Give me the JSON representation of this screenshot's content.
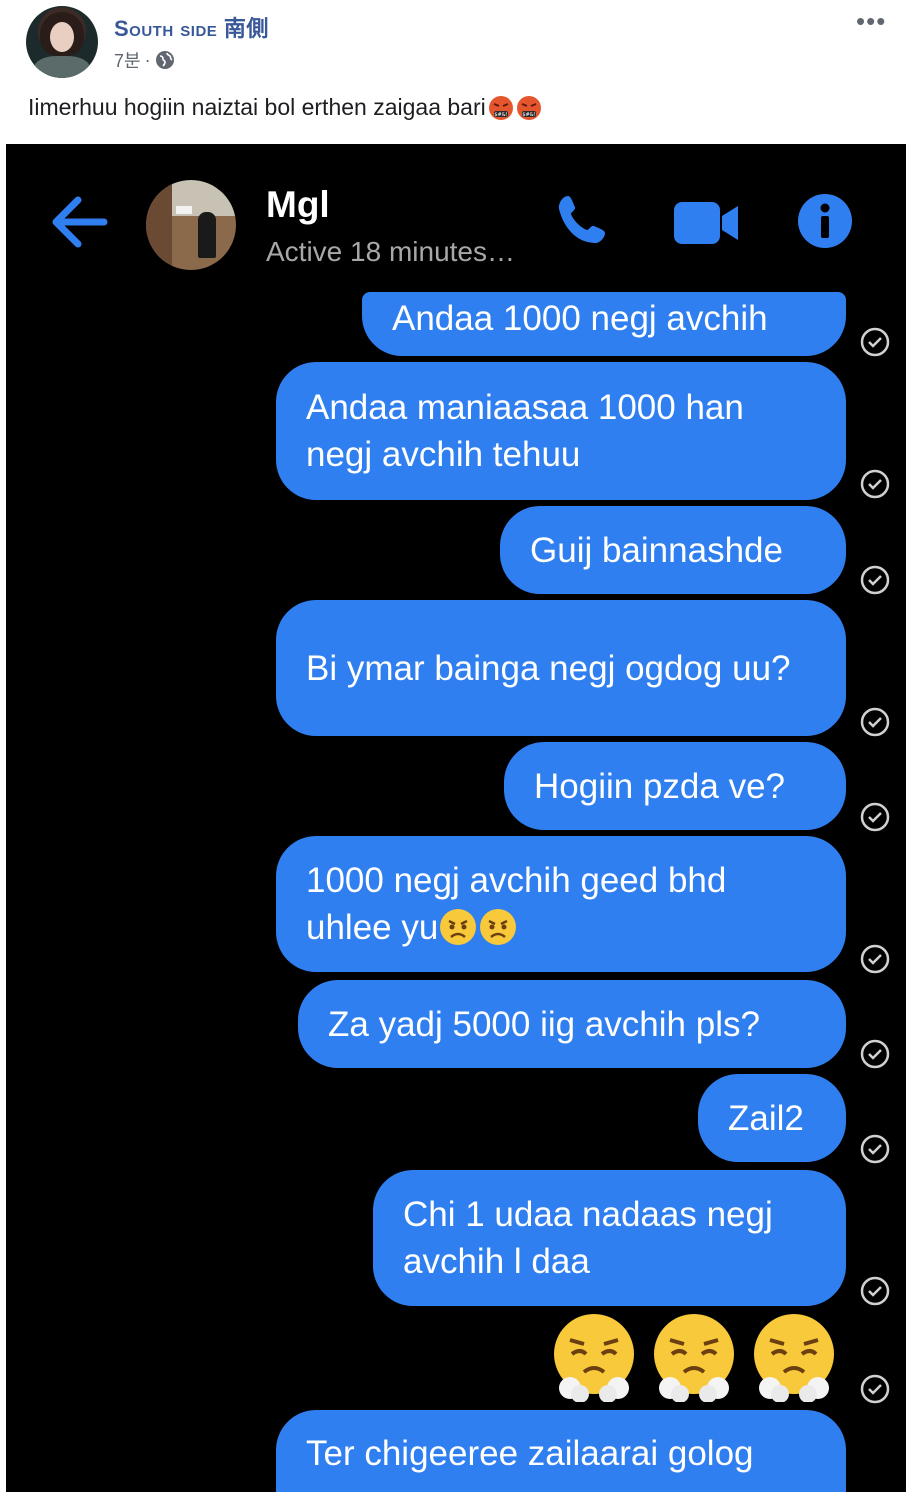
{
  "post": {
    "page_name": "South side 南側",
    "time": "7분",
    "separator": "·",
    "text": "Iimerhuu hogiin naiztai bol erthen zaigaa bari",
    "icons": [
      "globe-icon",
      "more-icon",
      "angry-face-icon"
    ]
  },
  "messenger": {
    "contact_name": "Mgl",
    "status": "Active 18 minutes…",
    "accent_color": "#2f7ff0",
    "background": "#000000",
    "messages": [
      {
        "text": "Andaa 1000 negj avchih"
      },
      {
        "text": "Andaa maniaasaa 1000 han negj avchih tehuu"
      },
      {
        "text": "Guij bainnashde"
      },
      {
        "text": "Bi ymar bainga negj ogdog uu?"
      },
      {
        "text": "Hogiin pzda ve?"
      },
      {
        "text": "1000 negj avchih geed bhd uhlee yu"
      },
      {
        "text": "Za yadj 5000 iig avchih pls?"
      },
      {
        "text": "Zail2"
      },
      {
        "text": "Chi 1 udaa nadaas negj avchih l daa"
      },
      {
        "text": "Ter chigeeree zailaarai golog"
      }
    ],
    "emoji_message": [
      "face-with-steam-icon",
      "face-with-steam-icon",
      "face-with-steam-icon"
    ]
  }
}
